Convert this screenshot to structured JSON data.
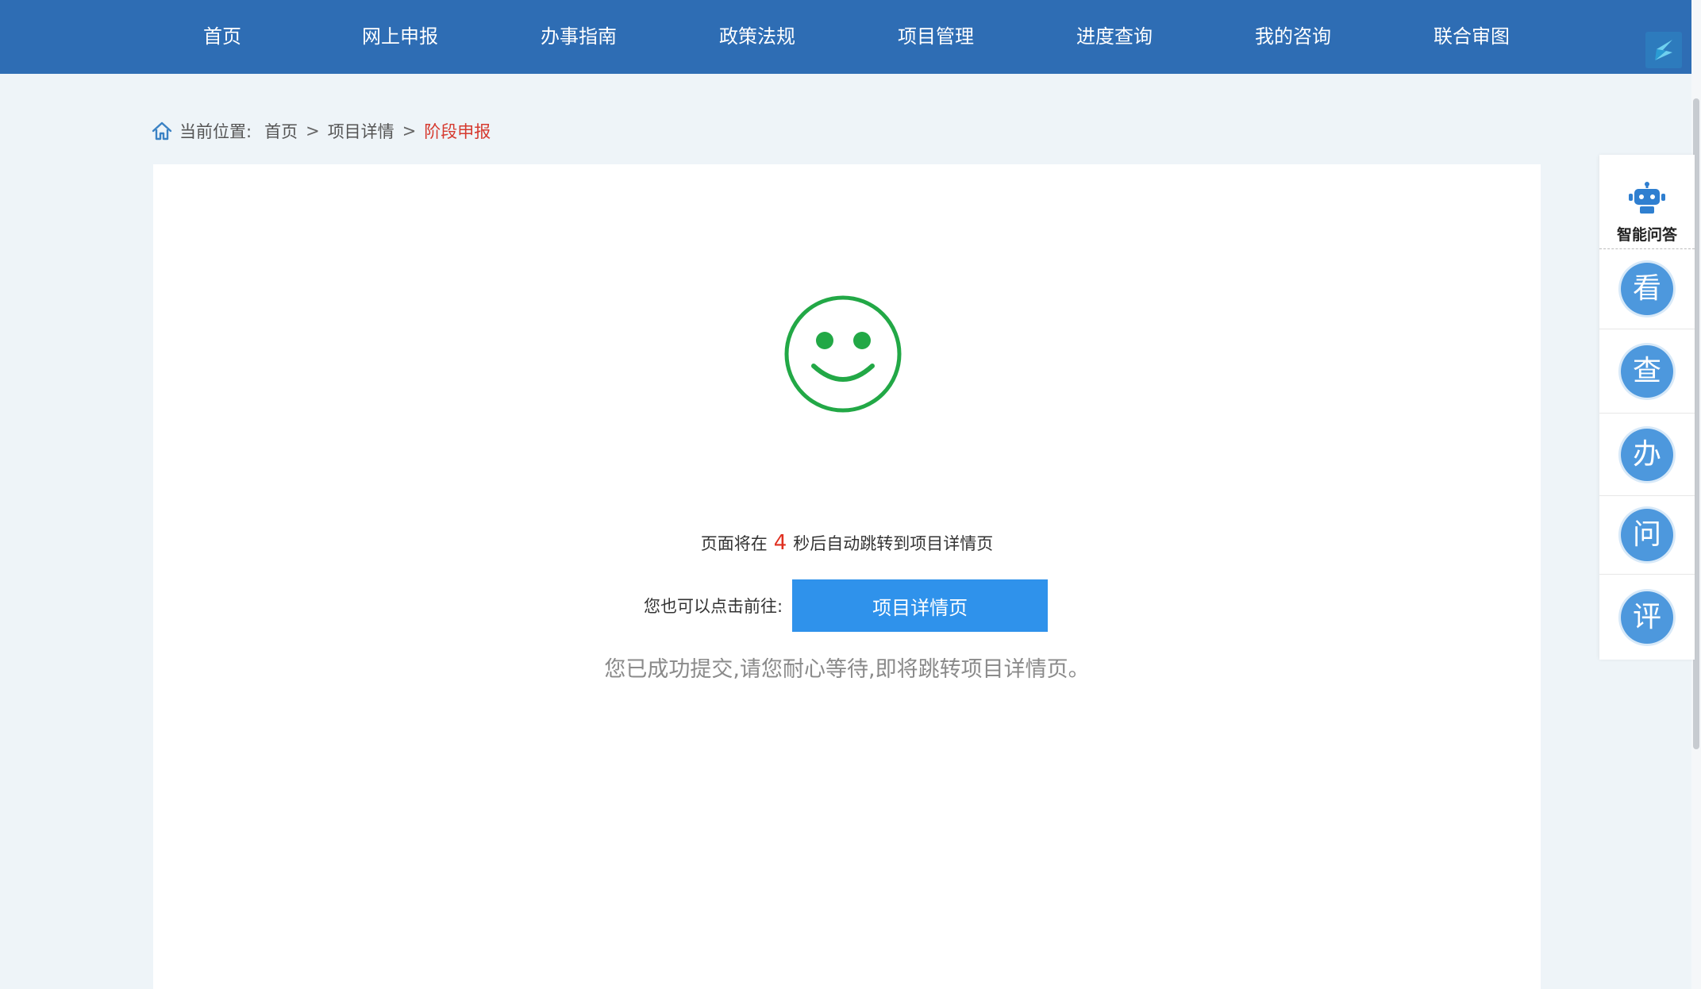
{
  "nav": {
    "items": [
      "首页",
      "网上申报",
      "办事指南",
      "政策法规",
      "项目管理",
      "进度查询",
      "我的咨询",
      "联合审图"
    ]
  },
  "breadcrumb": {
    "label": "当前位置:",
    "items": [
      "首页",
      "项目详情"
    ],
    "current": "阶段申报",
    "separator": ">"
  },
  "redirect": {
    "prefix": "页面将在",
    "seconds": "4",
    "suffix": "秒后自动跳转到项目详情页",
    "goto_label": "您也可以点击前往:",
    "goto_button": "项目详情页",
    "success_message": "您已成功提交,请您耐心等待,即将跳转项目详情页。"
  },
  "side_panel": {
    "assistant_label": "智能问答",
    "items": [
      "看",
      "查",
      "办",
      "问",
      "评"
    ]
  },
  "colors": {
    "nav_bg": "#2e6db4",
    "accent_blue": "#2f92eb",
    "success_green": "#22a846",
    "highlight_red": "#e03020"
  },
  "icons": {
    "breadcrumb": "home-icon",
    "result": "smiley-icon",
    "assistant": "robot-icon",
    "corner": "logo-icon"
  }
}
